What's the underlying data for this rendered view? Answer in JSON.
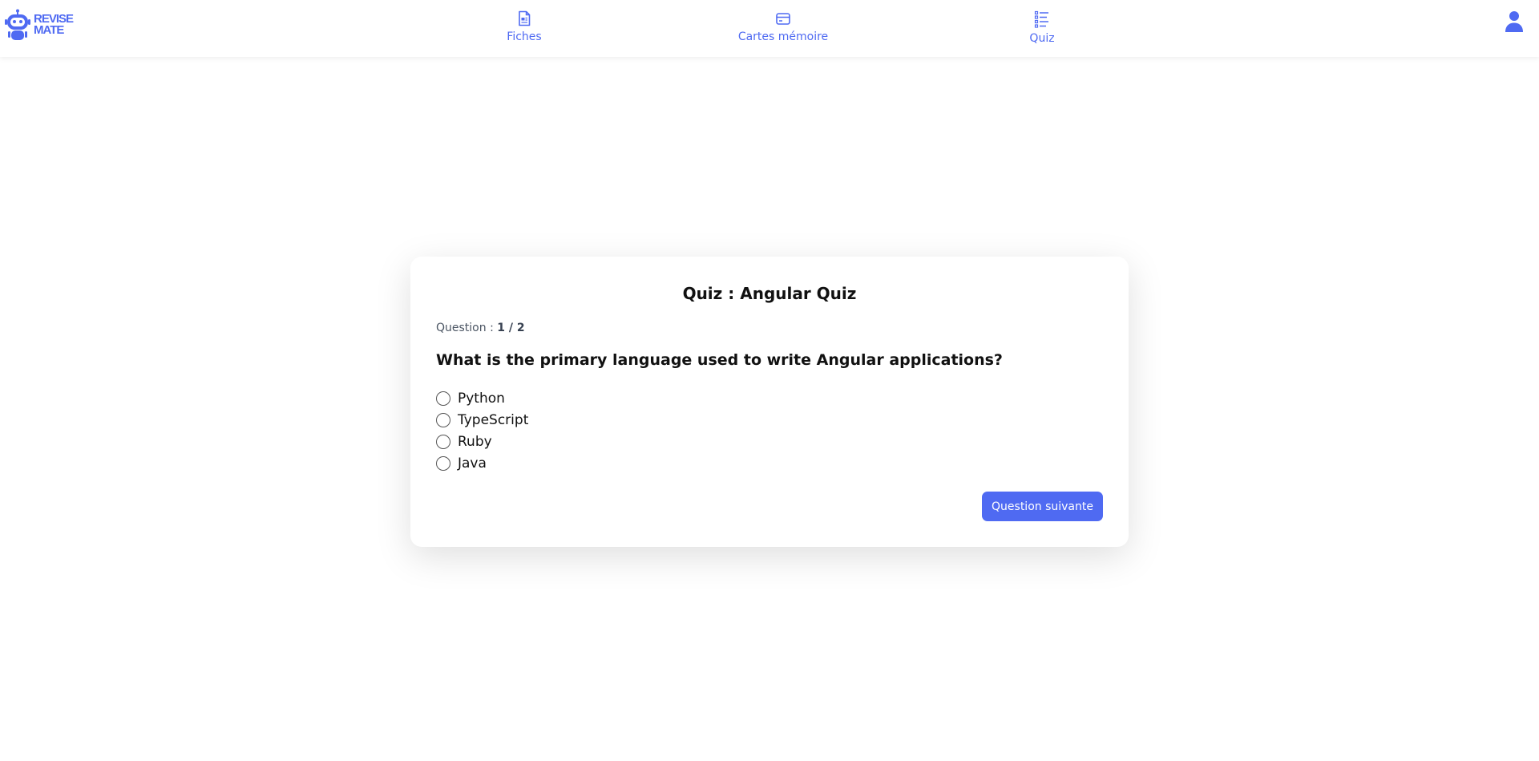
{
  "app": {
    "logo_text_line1": "REVISE",
    "logo_text_line2": "MATE"
  },
  "nav": {
    "items": [
      {
        "label": "Fiches",
        "icon": "document-icon"
      },
      {
        "label": "Cartes mémoire",
        "icon": "card-icon"
      },
      {
        "label": "Quiz",
        "icon": "list-icon"
      }
    ],
    "user_icon": "user-icon"
  },
  "quiz": {
    "title": "Quiz : Angular Quiz",
    "progress_label": "Question : ",
    "progress_value": "1 / 2",
    "question": "What is the primary language used to write Angular applications?",
    "options": [
      "Python",
      "TypeScript",
      "Ruby",
      "Java"
    ],
    "next_label": "Question suivante"
  },
  "colors": {
    "accent": "#4f6af2",
    "text": "#111111"
  }
}
